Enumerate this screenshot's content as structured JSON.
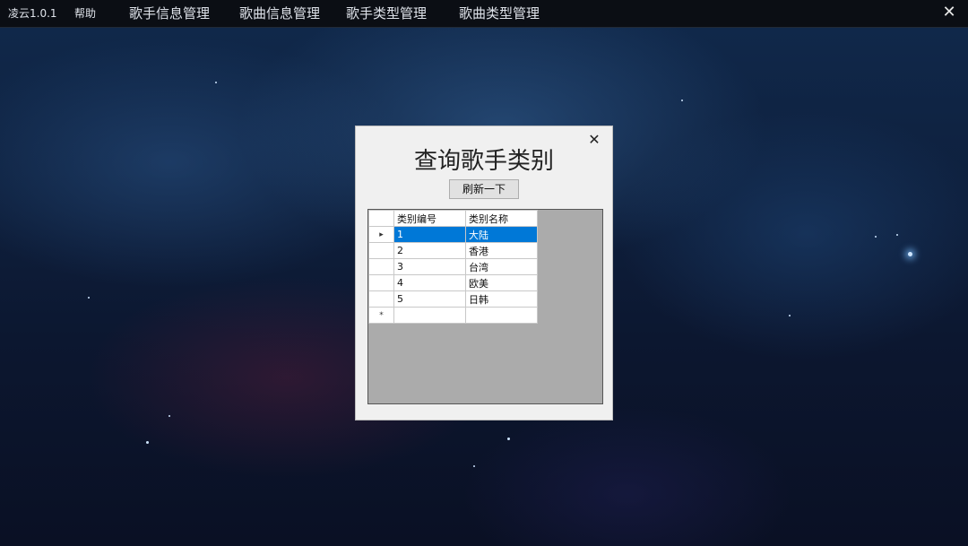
{
  "menubar": {
    "app_version": "凌云1.0.1",
    "help": "帮助",
    "items": [
      {
        "label": "歌手信息管理"
      },
      {
        "label": "歌曲信息管理"
      },
      {
        "label": "歌手类型管理"
      },
      {
        "label": "歌曲类型管理"
      }
    ],
    "close_glyph": "✕"
  },
  "dialog": {
    "title": "查询歌手类别",
    "close_glyph": "✕",
    "refresh_label": "刷新一下",
    "grid": {
      "columns": [
        "类别编号",
        "类别名称"
      ],
      "rows": [
        {
          "id": "1",
          "name": "大陆",
          "selected": true
        },
        {
          "id": "2",
          "name": "香港",
          "selected": false
        },
        {
          "id": "3",
          "name": "台湾",
          "selected": false
        },
        {
          "id": "4",
          "name": "欧美",
          "selected": false
        },
        {
          "id": "5",
          "name": "日韩",
          "selected": false
        }
      ],
      "current_row_marker": "▸",
      "new_row_marker": "*",
      "selection_color": "#0078d7"
    }
  },
  "colors": {
    "menubar_bg": "#0b0e14",
    "dialog_bg": "#f0f0f0",
    "grid_bg": "#ababab"
  }
}
